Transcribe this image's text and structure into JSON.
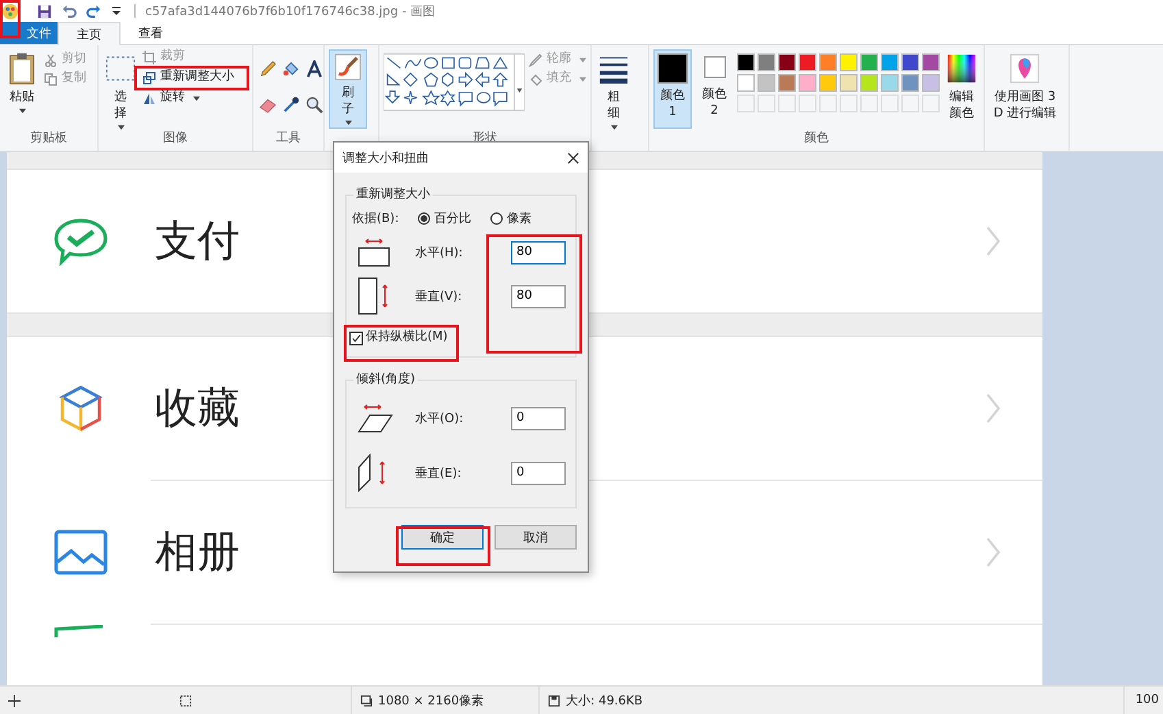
{
  "window": {
    "title": "c57afa3d144076b7f6b10f176746c38.jpg - 画图"
  },
  "tabs": [
    {
      "label": "文件",
      "selected": false,
      "kind": "file"
    },
    {
      "label": "主页",
      "selected": true,
      "kind": "tab"
    },
    {
      "label": "查看",
      "selected": false,
      "kind": "tab"
    }
  ],
  "ribbon": {
    "clipboard": {
      "paste": "粘贴",
      "cut": "剪切",
      "copy": "复制",
      "label": "剪贴板"
    },
    "image": {
      "select": "选择",
      "crop": "裁剪",
      "resize": "重新调整大小",
      "rotate": "旋转",
      "label": "图像"
    },
    "tools": {
      "label": "工具"
    },
    "brushes": {
      "label": "刷子"
    },
    "shapes": {
      "outline": "轮廓",
      "fill": "填充",
      "label": "形状"
    },
    "size": {
      "label": "粗细"
    },
    "colors": {
      "color1": "颜色 1",
      "color2": "颜色 2",
      "edit": "编辑颜色",
      "label": "颜色",
      "palette": [
        {
          "color": "#000000"
        },
        {
          "color": "#7f7f7f"
        },
        {
          "color": "#880015"
        },
        {
          "color": "#ed1c24"
        },
        {
          "color": "#ff7f27"
        },
        {
          "color": "#fff200"
        },
        {
          "color": "#22b14c"
        },
        {
          "color": "#00a2e8"
        },
        {
          "color": "#3f48cc"
        },
        {
          "color": "#a349a4"
        },
        {
          "color": "#ffffff"
        },
        {
          "color": "#c3c3c3"
        },
        {
          "color": "#b97a57"
        },
        {
          "color": "#ffaec9"
        },
        {
          "color": "#ffc90e"
        },
        {
          "color": "#efe4b0"
        },
        {
          "color": "#b5e61d"
        },
        {
          "color": "#99d9ea"
        },
        {
          "color": "#7092be"
        },
        {
          "color": "#c8bfe7"
        }
      ]
    },
    "paint3d": {
      "label": "使用画图 3D 进行编辑"
    }
  },
  "canvas": {
    "rows": [
      {
        "label": "支付",
        "kind": "pay"
      },
      {
        "label": "收藏",
        "kind": "favorites"
      },
      {
        "label": "相册",
        "kind": "album"
      }
    ]
  },
  "dialog": {
    "title": "调整大小和扭曲",
    "resize": {
      "title": "重新调整大小",
      "by": "依据(B):",
      "options": [
        {
          "label": "百分比",
          "selected": true
        },
        {
          "label": "像素",
          "selected": false
        }
      ],
      "fields": [
        {
          "label": "水平(H):",
          "value": "80",
          "kind": "horizontal",
          "focused": true
        },
        {
          "label": "垂直(V):",
          "value": "80",
          "kind": "vertical",
          "focused": false
        }
      ],
      "keep_ratio": {
        "label": "保持纵横比(M)",
        "checked": true
      }
    },
    "skew": {
      "title": "倾斜(角度)",
      "fields": [
        {
          "label": "水平(O):",
          "value": "0",
          "kind": "horizontal",
          "focused": false
        },
        {
          "label": "垂直(E):",
          "value": "0",
          "kind": "vertical",
          "focused": false
        }
      ]
    },
    "buttons": [
      "确定",
      "取消"
    ]
  },
  "status_bar": {
    "dimensions": "1080 × 2160像素",
    "size": "大小: 49.6KB",
    "zoom": "100"
  }
}
